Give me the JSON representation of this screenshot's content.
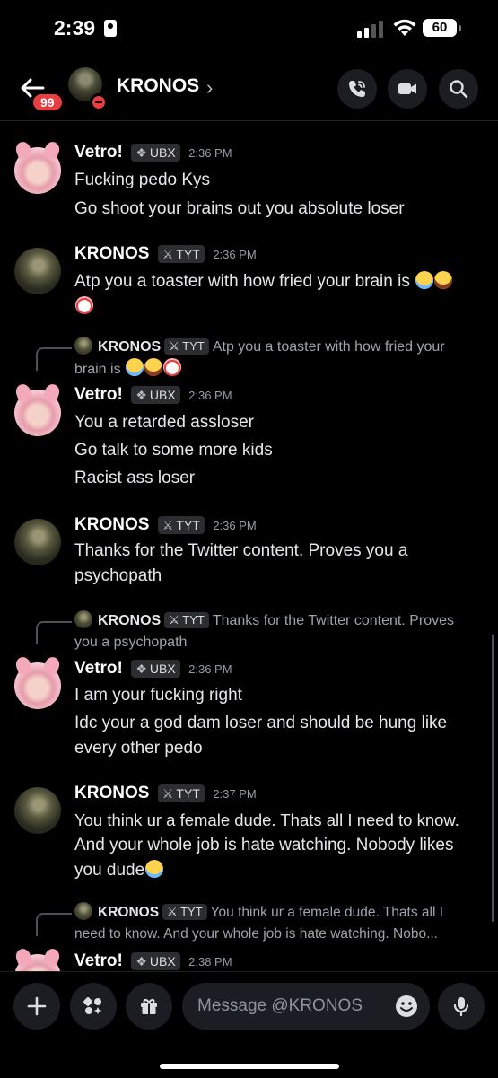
{
  "status_bar": {
    "time": "2:39",
    "battery": "60"
  },
  "header": {
    "unread_count": "99",
    "title": "KRONOS",
    "chevron": "›"
  },
  "messages": [
    {
      "author": "Vetro!",
      "tag": "UBX",
      "time": "2:36 PM",
      "lines": [
        "Fucking pedo Kys",
        "Go shoot your brains out you absolute loser"
      ]
    },
    {
      "author": "KRONOS",
      "tag": "TYT",
      "time": "2:36 PM",
      "lines": [
        "Atp you a toaster with how fried your brain is"
      ]
    },
    {
      "reply": {
        "author": "KRONOS",
        "tag": "TYT",
        "text_1": "Atp you a toaster with how fried your",
        "text_2": "brain is"
      },
      "author": "Vetro!",
      "tag": "UBX",
      "time": "2:36 PM",
      "lines": [
        "You a retarded assloser",
        "Go talk to some more kids",
        "Racist ass loser"
      ]
    },
    {
      "author": "KRONOS",
      "tag": "TYT",
      "time": "2:36 PM",
      "lines": [
        "Thanks for the Twitter content. Proves you a",
        "psychopath"
      ]
    },
    {
      "reply": {
        "author": "KRONOS",
        "tag": "TYT",
        "text_1": "Thanks for the Twitter content. Proves",
        "text_2": "you a psychopath"
      },
      "author": "Vetro!",
      "tag": "UBX",
      "time": "2:36 PM",
      "lines": [
        "I am your fucking right",
        "Idc your a god dam loser and should be hung like",
        "every other pedo"
      ]
    },
    {
      "author": "KRONOS",
      "tag": "TYT",
      "time": "2:37 PM",
      "lines": [
        "You think ur a female dude. Thats all I need to know.",
        "And your whole job is hate watching. Nobody likes",
        "you dude"
      ]
    },
    {
      "reply": {
        "author": "KRONOS",
        "tag": "TYT",
        "text_1": "You think ur a female dude. Thats all I",
        "text_2": "need to know. And your whole job is hate watching. Nobo..."
      },
      "author": "Vetro!",
      "tag": "UBX",
      "time": "2:38 PM"
    }
  ],
  "composer": {
    "placeholder": "Message @KRONOS"
  },
  "icons": {
    "back": "arrow-left-icon",
    "call": "phone-call-icon",
    "video": "video-camera-icon",
    "search": "search-icon",
    "plus": "plus-icon",
    "apps": "apps-icon",
    "gift": "gift-icon",
    "emoji": "emoji-icon",
    "mic": "microphone-icon"
  }
}
